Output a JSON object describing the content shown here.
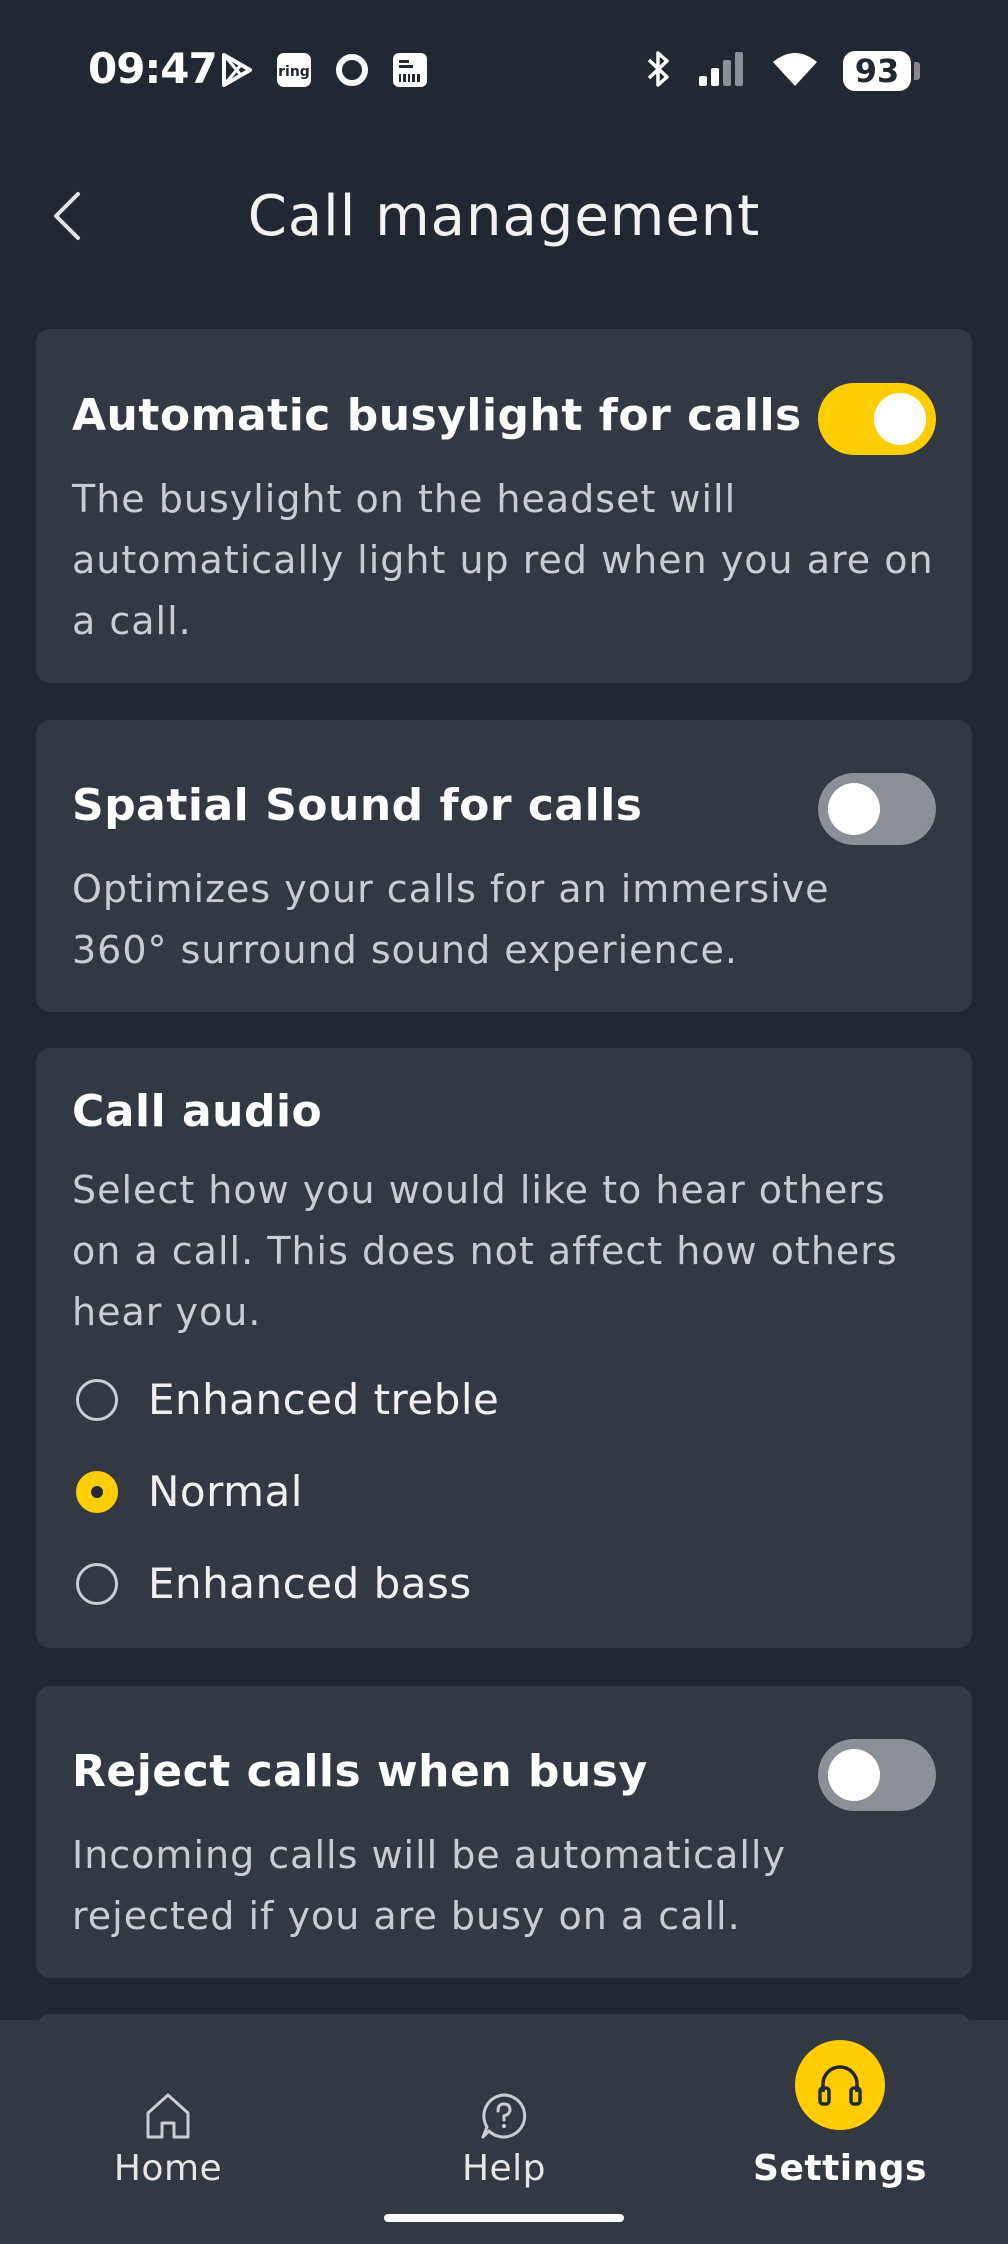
{
  "status_bar": {
    "time": "09:47",
    "left_icons": [
      "play-store-icon",
      "ring-icon",
      "circle-app-icon",
      "barcode-app-icon"
    ],
    "ring_label": "ring",
    "right_icons": [
      "bluetooth-icon",
      "signal-icon",
      "wifi-icon",
      "battery-icon"
    ],
    "battery": "93"
  },
  "header": {
    "title": "Call management",
    "back_icon": "chevron-left-icon"
  },
  "settings": {
    "busylight": {
      "title": "Automatic busylight for calls",
      "description": "The busylight on the headset will automatically light up red when you are on a call.",
      "enabled": true
    },
    "spatial_sound": {
      "title": "Spatial Sound for calls",
      "description": "Optimizes your calls for an immersive 360° surround sound experience.",
      "enabled": false
    },
    "call_audio": {
      "title": "Call audio",
      "description": "Select how you would like to hear others on a call. This does not affect how others hear you.",
      "options": [
        {
          "label": "Enhanced treble",
          "selected": false
        },
        {
          "label": "Normal",
          "selected": true
        },
        {
          "label": "Enhanced bass",
          "selected": false
        }
      ]
    },
    "reject_busy": {
      "title": "Reject calls when busy",
      "description": "Incoming calls will be automatically rejected if you are busy on a call.",
      "enabled": false
    }
  },
  "bottom_nav": {
    "items": [
      {
        "label": "Home",
        "icon": "home-icon",
        "active": false
      },
      {
        "label": "Help",
        "icon": "help-icon",
        "active": false
      },
      {
        "label": "Settings",
        "icon": "headphones-icon",
        "active": true
      }
    ]
  },
  "colors": {
    "background": "#222831",
    "card": "#333942",
    "accent": "#ffcd00",
    "toggle_off": "#8b9096"
  }
}
